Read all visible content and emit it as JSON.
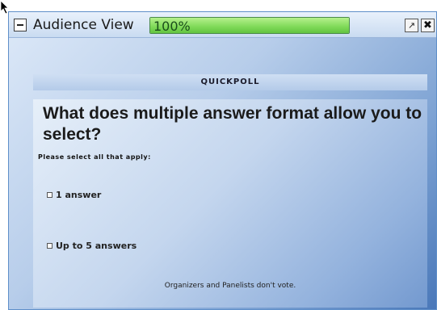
{
  "window": {
    "title": "Audience View",
    "progress": {
      "value": 100,
      "label": "100%"
    },
    "buttons": {
      "collapse_icon": "minus-icon",
      "popout_icon": "popout-icon",
      "close_icon": "close-icon"
    }
  },
  "poll": {
    "header": "QUICKPOLL",
    "question": "What does multiple answer format allow you to select?",
    "instructions": "Please select all that apply:",
    "options": [
      {
        "label": "1 answer",
        "checked": false
      },
      {
        "label": "Up to 5 answers",
        "checked": false
      }
    ],
    "footer": "Organizers and Panelists don't vote."
  },
  "colors": {
    "progress_fill": "#7ed957",
    "window_border": "#5f8fc9",
    "panel_blue": "#93b2dd"
  }
}
